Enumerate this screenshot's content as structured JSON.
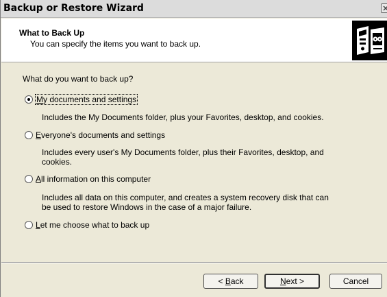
{
  "window": {
    "title": "Backup or Restore Wizard"
  },
  "header": {
    "title": "What to Back Up",
    "subtitle": "You can specify the items you want to back up.",
    "icon": "backup-tape-icon"
  },
  "main": {
    "question": "What do you want to back up?",
    "options": [
      {
        "mnemonic": "M",
        "label_rest": "y documents and settings",
        "checked": true,
        "description": "Includes the My Documents folder, plus your Favorites, desktop, and cookies."
      },
      {
        "mnemonic": "E",
        "label_rest": "veryone's documents and settings",
        "checked": false,
        "description": "Includes every user's My Documents folder, plus their Favorites, desktop, and cookies."
      },
      {
        "mnemonic": "A",
        "label_rest": "ll information on this computer",
        "checked": false,
        "description": "Includes all data on this computer, and creates a system recovery disk that can be used to restore Windows in the case of a major failure."
      },
      {
        "mnemonic": "L",
        "label_rest": "et me choose what to back up",
        "checked": false,
        "description": ""
      }
    ]
  },
  "footer": {
    "back": {
      "prefix": "< ",
      "mnemonic": "B",
      "rest": "ack"
    },
    "next": {
      "mnemonic": "N",
      "rest": "ext >"
    },
    "cancel": "Cancel"
  }
}
